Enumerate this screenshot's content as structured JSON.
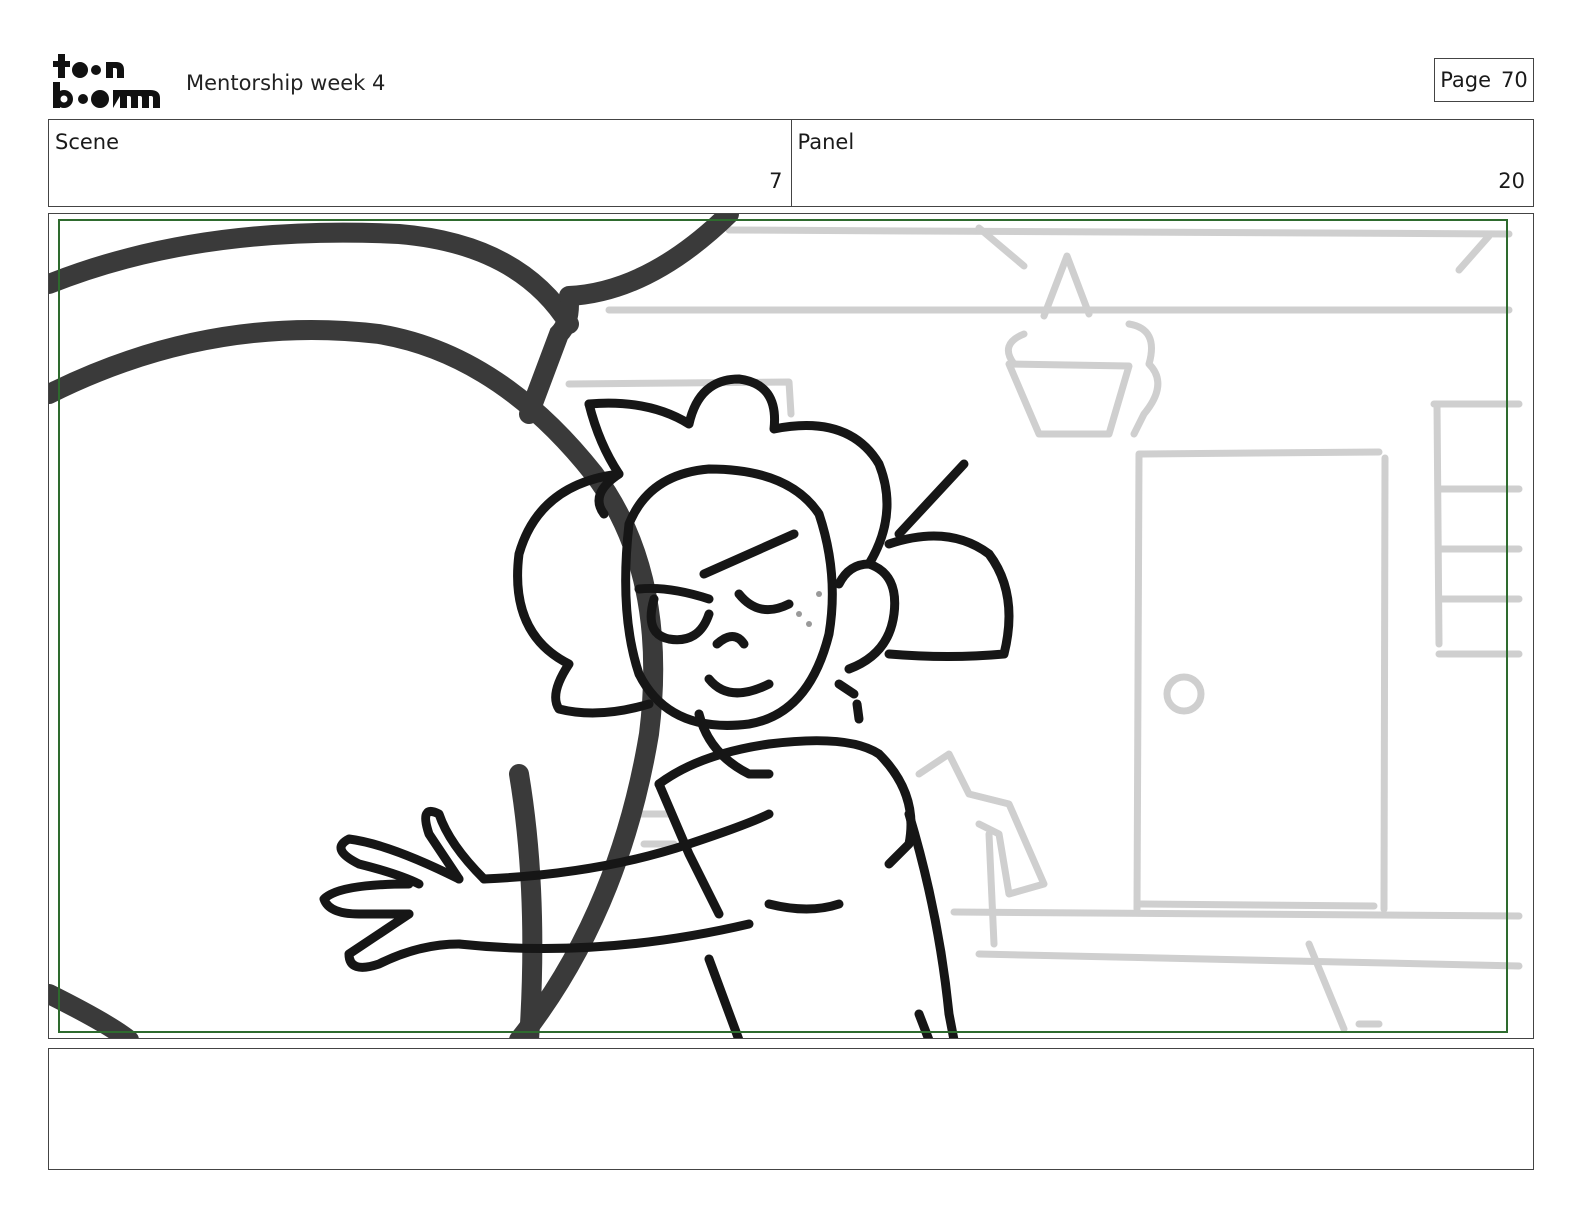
{
  "header": {
    "logo_text": "toon boom",
    "project_title": "Mentorship week 4",
    "page_label": "Page",
    "page_number": "70"
  },
  "info": {
    "scene_label": "Scene",
    "scene_value": "7",
    "panel_label": "Panel",
    "panel_value": "20"
  },
  "notes": {
    "text": ""
  },
  "colors": {
    "safe_frame": "#2e6b2e",
    "ink": "#161616",
    "foreground_gray": "#3a3a3a",
    "background_sketch": "#cdcdcd"
  }
}
